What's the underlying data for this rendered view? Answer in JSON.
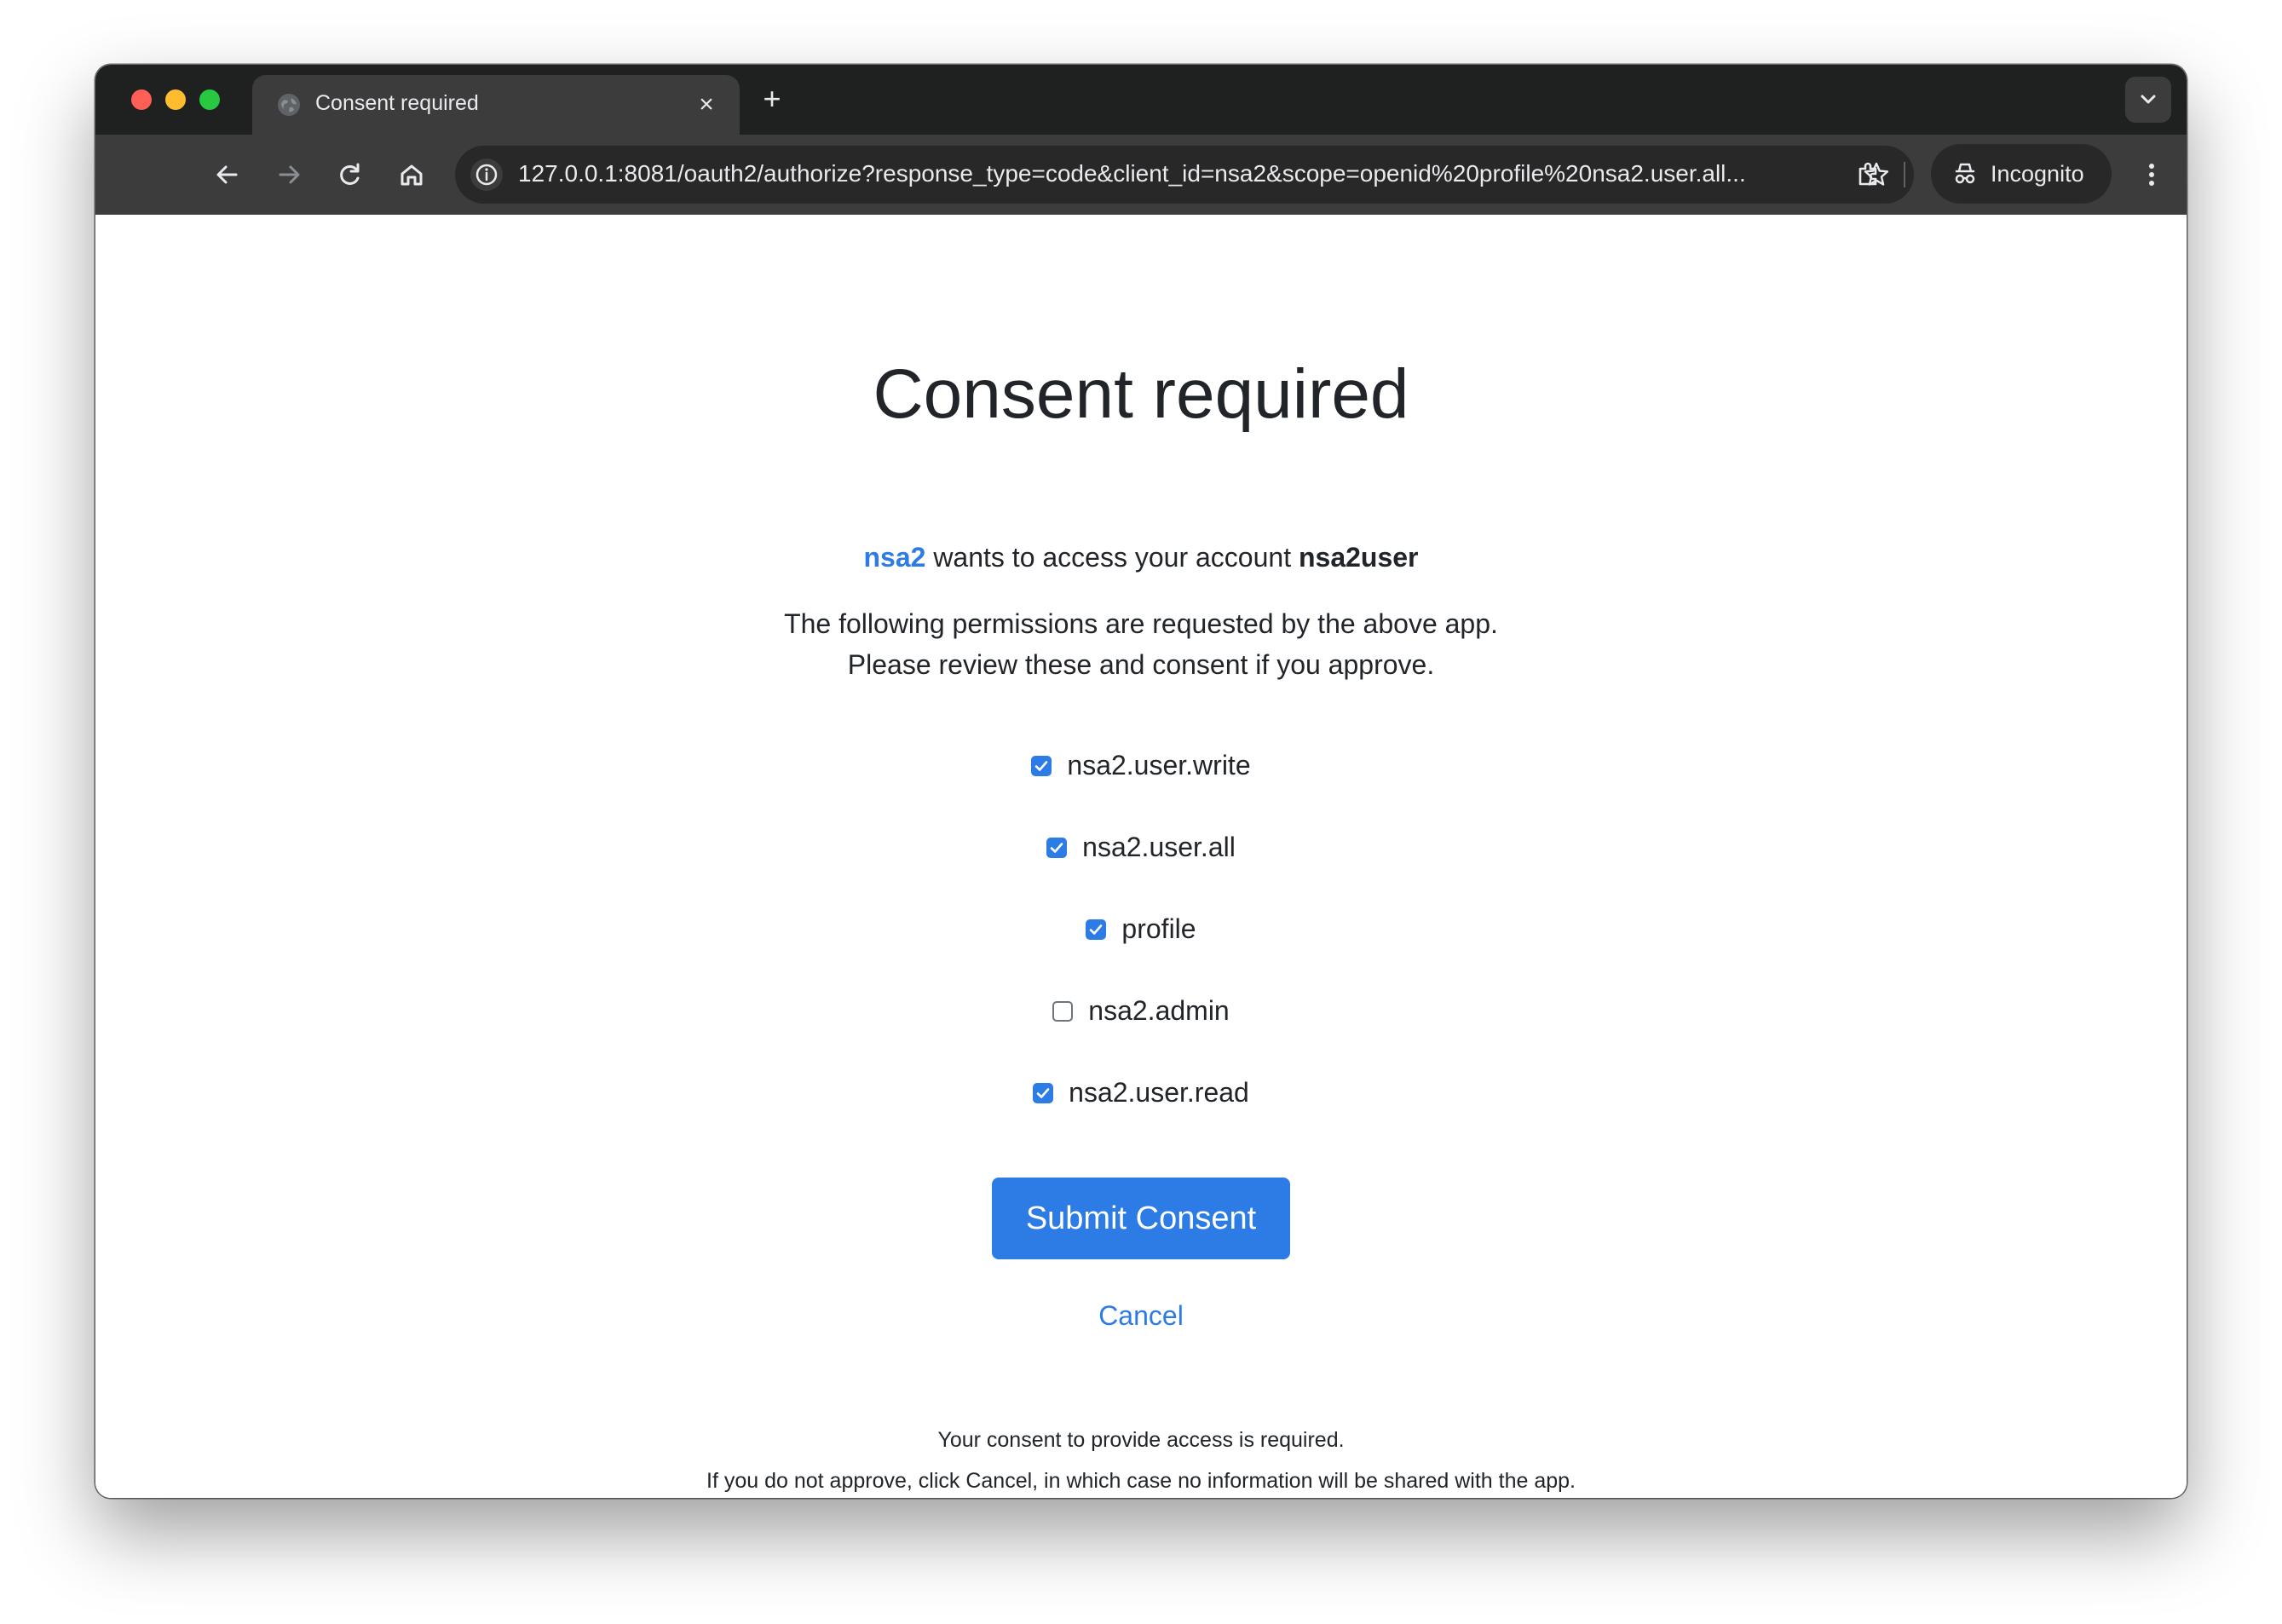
{
  "browser": {
    "tab_title": "Consent required",
    "new_tab_symbol": "+",
    "close_symbol": "×",
    "url": "127.0.0.1:8081/oauth2/authorize?response_type=code&client_id=nsa2&scope=openid%20profile%20nsa2.user.all...",
    "profile_label": "Incognito",
    "icons": [
      "globe-icon",
      "close-icon",
      "plus-icon",
      "chevron-down-icon",
      "back-arrow-icon",
      "forward-arrow-icon",
      "reload-icon",
      "home-icon",
      "info-icon",
      "star-icon",
      "extensions-icon",
      "incognito-icon",
      "kebab-menu-icon"
    ]
  },
  "consent": {
    "title": "Consent required",
    "client_name": "nsa2",
    "request_text": " wants to access your account ",
    "account_name": "nsa2user",
    "description_line1": "The following permissions are requested by the above app.",
    "description_line2": "Please review these and consent if you approve.",
    "scopes": [
      {
        "name": "nsa2.user.write",
        "checked": true
      },
      {
        "name": "nsa2.user.all",
        "checked": true
      },
      {
        "name": "profile",
        "checked": true
      },
      {
        "name": "nsa2.admin",
        "checked": false
      },
      {
        "name": "nsa2.user.read",
        "checked": true
      }
    ],
    "submit_label": "Submit Consent",
    "cancel_label": "Cancel",
    "footer_line1": "Your consent to provide access is required.",
    "footer_line2": "If you do not approve, click Cancel, in which case no information will be shared with the app."
  },
  "colors": {
    "accent": "#2d7be5",
    "text": "#212529",
    "tab_strip": "#1f2020",
    "toolbar": "#3c3c3c"
  }
}
